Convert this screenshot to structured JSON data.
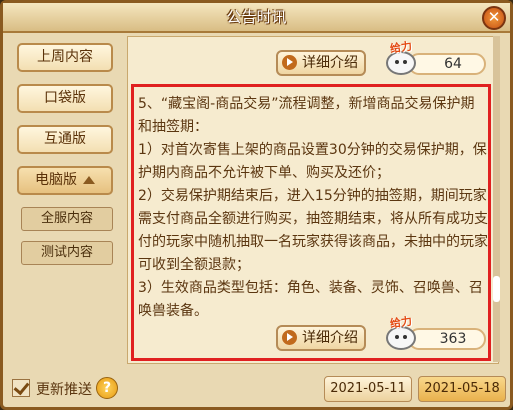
{
  "window": {
    "title": "公告时讯",
    "close_label": "✕"
  },
  "sidebar": {
    "items": [
      {
        "label": "上周内容"
      },
      {
        "label": "口袋版"
      },
      {
        "label": "互通版"
      },
      {
        "label": "电脑版"
      }
    ],
    "subitems": [
      {
        "label": "全服内容"
      },
      {
        "label": "测试内容"
      }
    ]
  },
  "content": {
    "top_detail_label": "详细介绍",
    "top_like_count": "64",
    "mascot_text": "给力",
    "article_lines": [
      "5、“藏宝阁-商品交易”流程调整，新增商品交易保护期和抽签期：",
      "1）对首次寄售上架的商品设置30分钟的交易保护期，保护期内商品不允许被下单、购买及还价；",
      "2）交易保护期结束后，进入15分钟的抽签期，期间玩家需支付商品全额进行购买，抽签期结束，将从所有成功支付的玩家中随机抽取一名玩家获得该商品，未抽中的玩家可收到全额退款；",
      "3）生效商品类型包括：角色、装备、灵饰、召唤兽、召唤兽装备。"
    ],
    "bottom_detail_label": "详细介绍",
    "bottom_like_count": "363"
  },
  "footer": {
    "checkbox_label": "更新推送",
    "help_label": "?",
    "dates": [
      "2021-05-11",
      "2021-05-18"
    ]
  }
}
